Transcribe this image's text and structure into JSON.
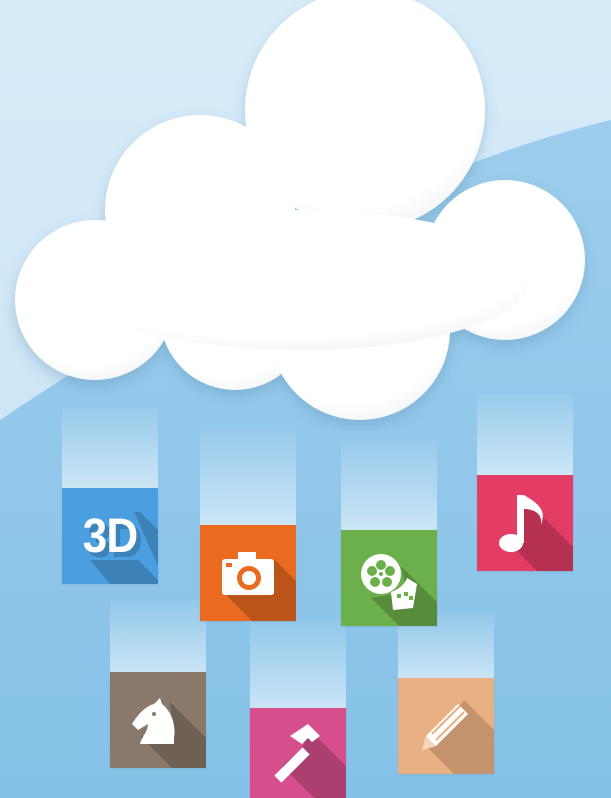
{
  "scene": {
    "colors": {
      "sky_light": "#cfe5f4",
      "sky_dark": "#8ec7ea",
      "cloud": "#ffffff"
    }
  },
  "tiles": [
    {
      "name": "3d-tile",
      "icon": "3d-text-icon",
      "label": "3D",
      "color": "#4a9fe0"
    },
    {
      "name": "camera-tile",
      "icon": "camera-icon",
      "color": "#ea6a1f"
    },
    {
      "name": "film-reel-tile",
      "icon": "film-reel-icon",
      "color": "#6cb04c"
    },
    {
      "name": "music-tile",
      "icon": "music-note-icon",
      "color": "#e33d66"
    },
    {
      "name": "chess-knight-tile",
      "icon": "chess-knight-icon",
      "color": "#8a786b"
    },
    {
      "name": "hammer-tile",
      "icon": "hammer-icon",
      "color": "#d64f8c"
    },
    {
      "name": "pencil-tile",
      "icon": "pencil-icon",
      "color": "#e9b083"
    }
  ]
}
